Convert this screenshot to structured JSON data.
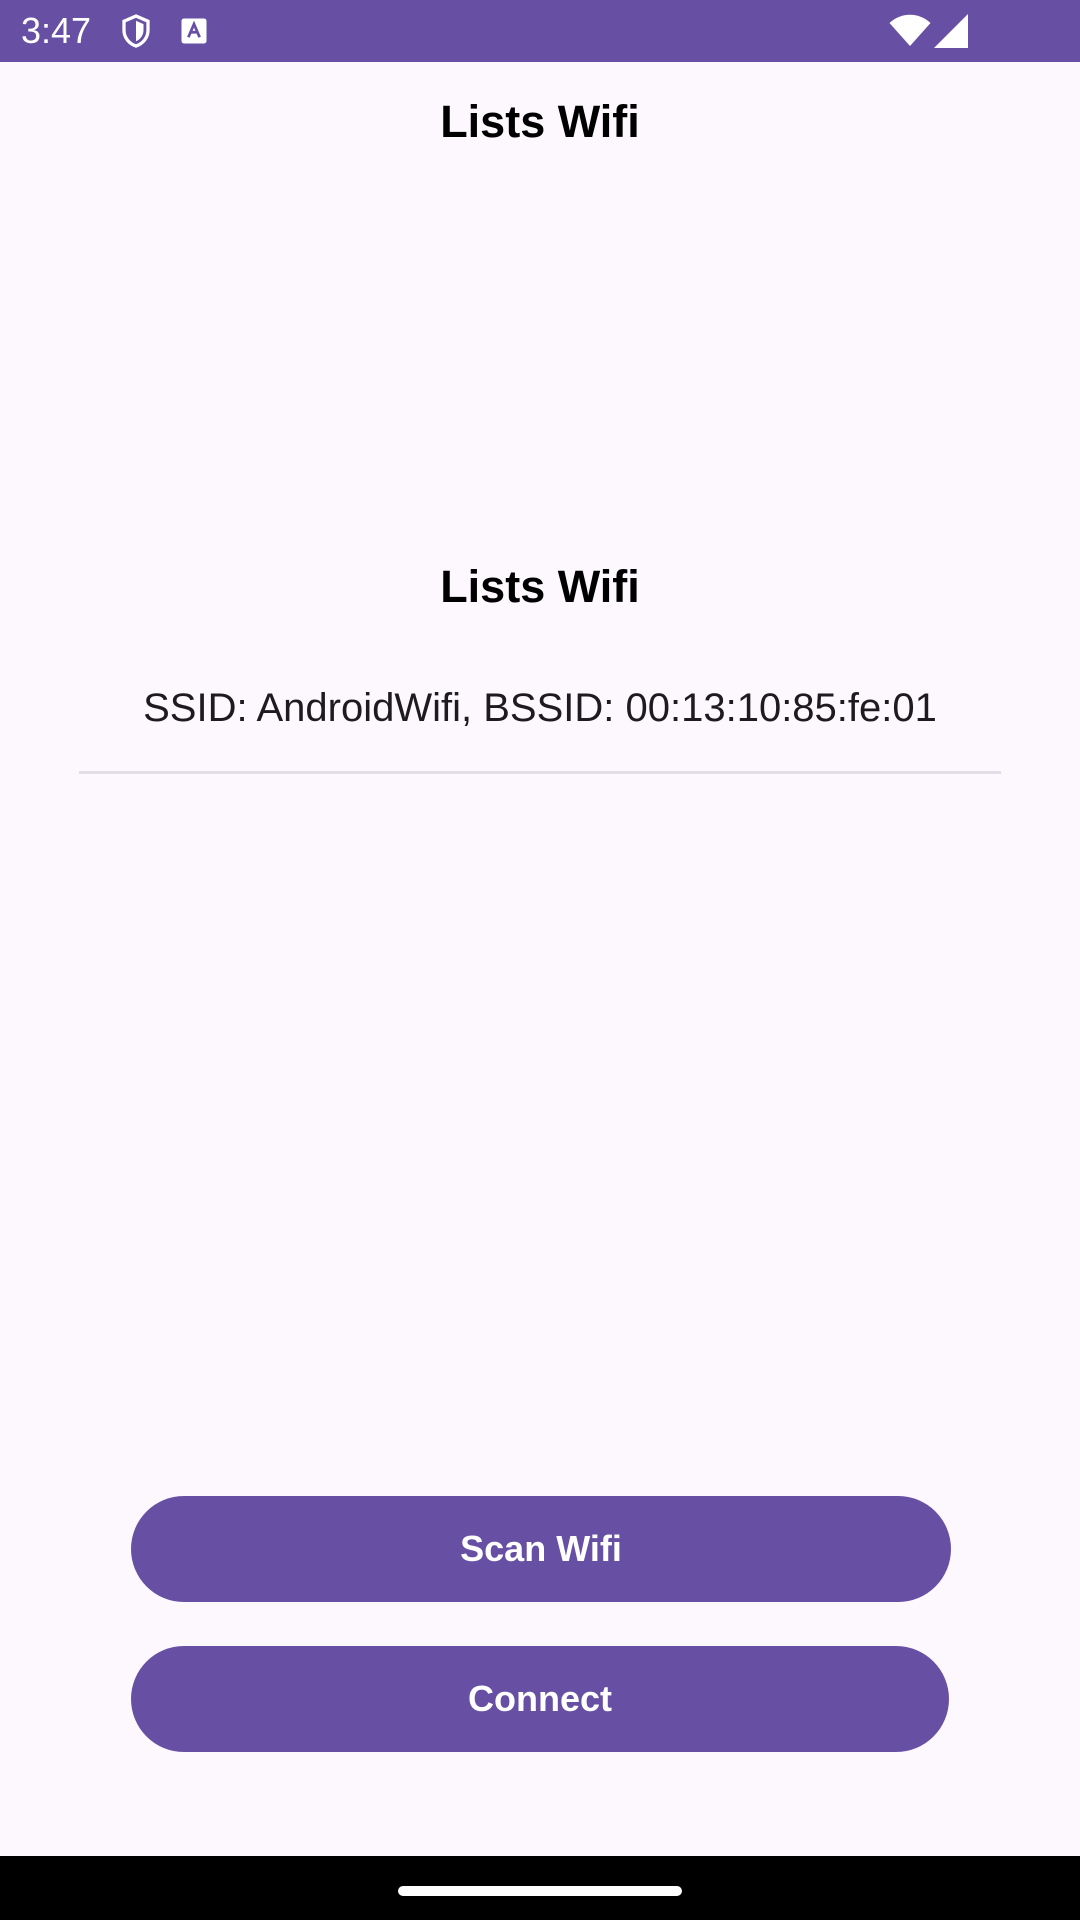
{
  "status_bar": {
    "time": "3:47",
    "icons": [
      "shield-icon",
      "text-a-icon",
      "wifi-icon",
      "cellular-signal-icon"
    ],
    "color": "#6750a4"
  },
  "screen": {
    "header_title": "Lists Wifi",
    "list_title": "Lists Wifi",
    "wifi_networks": [
      {
        "text": "SSID: AndroidWifi, BSSID: 00:13:10:85:fe:01"
      }
    ]
  },
  "buttons": {
    "scan_label": "Scan Wifi",
    "connect_label": "Connect"
  },
  "colors": {
    "accent": "#6750a4",
    "background": "#fdf7fe"
  }
}
